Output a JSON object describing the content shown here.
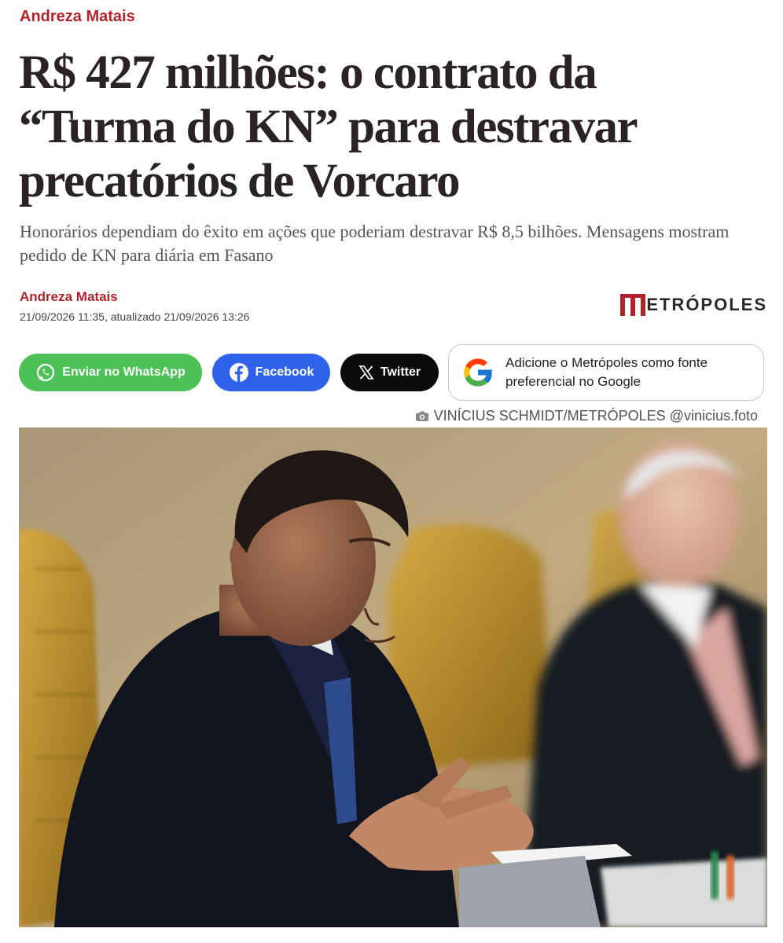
{
  "column": {
    "author": "Andreza Matais"
  },
  "article": {
    "headline": "R$ 427 milhões: o contrato da “Turma do KN” para destravar precatórios de Vorcaro",
    "subheadline": "Honorários dependiam do êxito em ações que poderiam destravar R$ 8,5 bilhões. Mensagens mostram pedido de KN para diária em Fasano",
    "author": "Andreza Matais",
    "dateline": "21/09/2026 11:35, atualizado 21/09/2026 13:26"
  },
  "brand": {
    "name": "METRÓPOLES",
    "color": "#b1232a"
  },
  "share": {
    "whatsapp_label": "Enviar no WhatsApp",
    "facebook_label": "Facebook",
    "twitter_label": "Twitter",
    "google_line1": "Adicione o Metrópoles como fonte",
    "google_line2": "preferencial no Google"
  },
  "photo": {
    "credit": "VINÍCIUS SCHMIDT/METRÓPOLES @vinicius.foto"
  },
  "colors": {
    "accent": "#b1232a",
    "whatsapp": "#4bc157",
    "facebook": "#2f62e8",
    "twitter": "#0b0b0b"
  },
  "icons": [
    "whatsapp-icon",
    "facebook-icon",
    "x-icon",
    "google-icon",
    "camera-icon"
  ]
}
